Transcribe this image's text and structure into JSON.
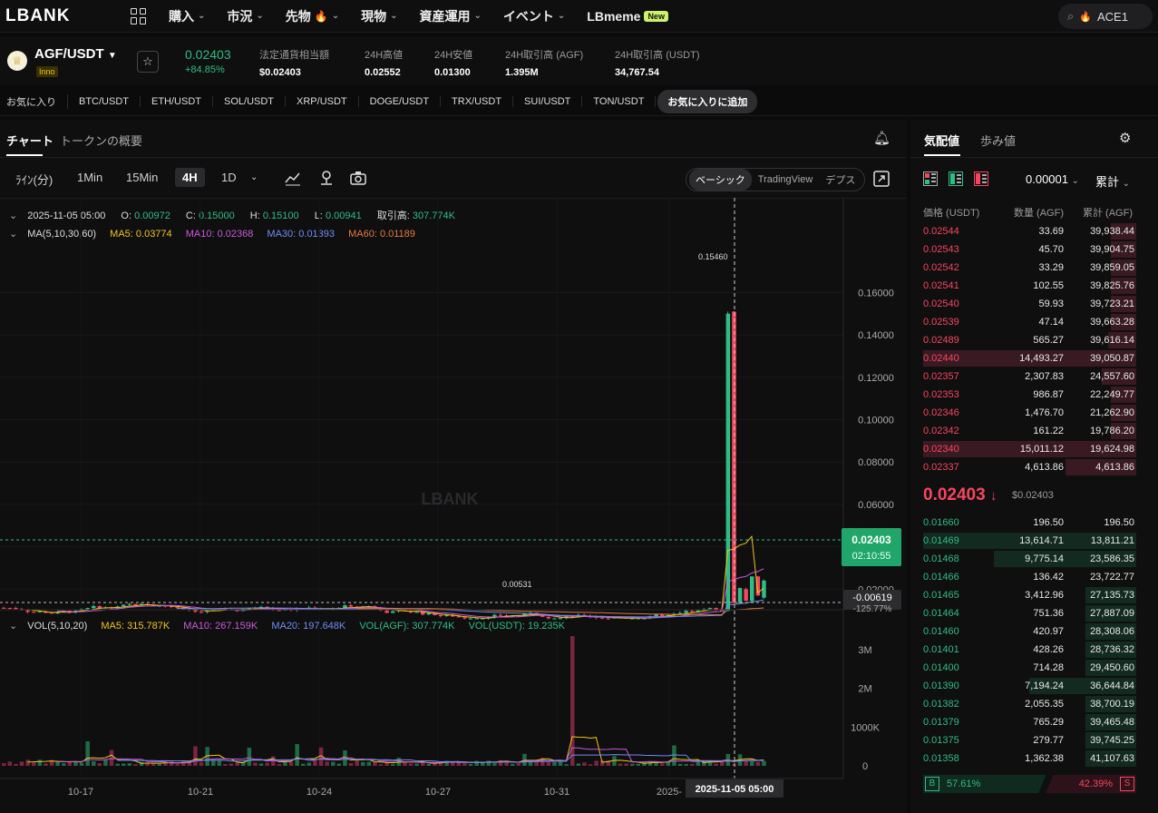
{
  "nav": {
    "logo": "LBANK",
    "items": [
      {
        "label": "購入",
        "chevron": true,
        "fire": false
      },
      {
        "label": "市況",
        "chevron": true,
        "fire": false
      },
      {
        "label": "先物",
        "chevron": true,
        "fire": true
      },
      {
        "label": "現物",
        "chevron": true,
        "fire": false
      },
      {
        "label": "資産運用",
        "chevron": true,
        "fire": false
      },
      {
        "label": "イベント",
        "chevron": true,
        "fire": false
      },
      {
        "label": "LBmeme",
        "chevron": false,
        "fire": false
      }
    ],
    "new_badge": "New",
    "search_value": "ACE1"
  },
  "ticker": {
    "pair": "AGF/USDT",
    "tag": "Inno",
    "price": "0.02403",
    "change": "+84.85%",
    "stats": [
      {
        "label": "法定通貨相当額",
        "value": "$0.02403"
      },
      {
        "label": "24H高値",
        "value": "0.02552"
      },
      {
        "label": "24H安値",
        "value": "0.01300"
      },
      {
        "label": "24H取引高 (AGF)",
        "value": "1.395M"
      },
      {
        "label": "24H取引高 (USDT)",
        "value": "34,767.54"
      }
    ]
  },
  "favbar": {
    "title": "お気に入り",
    "pairs": [
      "BTC/USDT",
      "ETH/USDT",
      "SOL/USDT",
      "XRP/USDT",
      "DOGE/USDT",
      "TRX/USDT",
      "SUI/USDT",
      "TON/USDT"
    ],
    "add_label": "お気に入りに追加"
  },
  "chart_panel": {
    "tabs": [
      "チャート",
      "トークンの概要"
    ],
    "timeframes": [
      "ﾗｲﾝ(分)",
      "1Min",
      "15Min",
      "4H",
      "1D"
    ],
    "active_timeframe": "4H",
    "views": [
      "ベーシック",
      "TradingView",
      "デプス"
    ],
    "active_view": "ベーシック",
    "ohlc": {
      "date": "2025-11-05 05:00",
      "o_label": "O:",
      "o": "0.00972",
      "c_label": "C:",
      "c": "0.15000",
      "h_label": "H:",
      "h": "0.15100",
      "l_label": "L:",
      "l": "0.00941",
      "vol_label": "取引高:",
      "vol": "307.774K"
    },
    "ma": {
      "label": "MA(5,10,30,60)",
      "ma5": "MA5: 0.03774",
      "ma10": "MA10: 0.02368",
      "ma30": "MA30: 0.01393",
      "ma60": "MA60: 0.01189"
    },
    "vol": {
      "label": "VOL(5,10,20)",
      "ma5": "MA5: 315.787K",
      "ma10": "MA10: 267.159K",
      "ma20": "MA20: 197.648K",
      "agf": "VOL(AGF): 307.774K",
      "usdt": "VOL(USDT): 19.235K"
    },
    "watermark": "LBANK",
    "price_tag": "0.02403",
    "countdown": "02:10:55",
    "low_tag": "-0.00619",
    "low_pct": "-125.77%",
    "high_marker": "0.15460",
    "low_marker": "0.00531",
    "crosshair_date": "2025-11-05 05:00"
  },
  "chart_data": {
    "type": "candlestick",
    "price_axis": {
      "ticks": [
        "0.16000",
        "0.14000",
        "0.12000",
        "0.10000",
        "0.08000",
        "0.06000",
        "0.04000",
        "0.02000"
      ],
      "range": [
        0,
        0.17
      ]
    },
    "volume_axis": {
      "ticks": [
        "3M",
        "2M",
        "1000K",
        "0"
      ],
      "range": [
        0,
        3500000
      ]
    },
    "x_ticks": [
      "10-17",
      "10-21",
      "10-24",
      "10-27",
      "10-31",
      "2025-"
    ],
    "notable": {
      "spike_high": 0.1546,
      "period_low": 0.00531,
      "last": 0.02403
    },
    "base_price": 0.0112,
    "spike_open": 0.00972,
    "spike_close": 0.15,
    "spike_high": 0.151
  },
  "orderbook": {
    "tabs": [
      "気配値",
      "歩み値"
    ],
    "tick": "0.00001",
    "mode": "累計",
    "cols": [
      "価格 (USDT)",
      "数量 (AGF)",
      "累計 (AGF)"
    ],
    "asks": [
      {
        "p": "0.02544",
        "q": "33.69",
        "t": "39,938.44",
        "d": 0.12
      },
      {
        "p": "0.02543",
        "q": "45.70",
        "t": "39,904.75",
        "d": 0.12
      },
      {
        "p": "0.02542",
        "q": "33.29",
        "t": "39,859.05",
        "d": 0.12
      },
      {
        "p": "0.02541",
        "q": "102.55",
        "t": "39,825.76",
        "d": 0.12
      },
      {
        "p": "0.02540",
        "q": "59.93",
        "t": "39,723.21",
        "d": 0.12
      },
      {
        "p": "0.02539",
        "q": "47.14",
        "t": "39,663.28",
        "d": 0.12
      },
      {
        "p": "0.02489",
        "q": "565.27",
        "t": "39,616.14",
        "d": 0.13
      },
      {
        "p": "0.02440",
        "q": "14,493.27",
        "t": "39,050.87",
        "d": 1.0
      },
      {
        "p": "0.02357",
        "q": "2,307.83",
        "t": "24,557.60",
        "d": 0.16
      },
      {
        "p": "0.02353",
        "q": "986.87",
        "t": "22,249.77",
        "d": 0.12
      },
      {
        "p": "0.02346",
        "q": "1,476.70",
        "t": "21,262.90",
        "d": 0.12
      },
      {
        "p": "0.02342",
        "q": "161.22",
        "t": "19,786.20",
        "d": 0.12
      },
      {
        "p": "0.02340",
        "q": "15,011.12",
        "t": "19,624.98",
        "d": 1.0
      },
      {
        "p": "0.02337",
        "q": "4,613.86",
        "t": "4,613.86",
        "d": 0.33
      }
    ],
    "mid_price": "0.02403",
    "mid_fiat": "$0.02403",
    "bids": [
      {
        "p": "0.01660",
        "q": "196.50",
        "t": "196.50",
        "d": 0.0
      },
      {
        "p": "0.01469",
        "q": "13,614.71",
        "t": "13,811.21",
        "d": 1.0
      },
      {
        "p": "0.01468",
        "q": "9,775.14",
        "t": "23,586.35",
        "d": 0.67
      },
      {
        "p": "0.01466",
        "q": "136.42",
        "t": "23,722.77",
        "d": 0.0
      },
      {
        "p": "0.01465",
        "q": "3,412.96",
        "t": "27,135.73",
        "d": 0.24
      },
      {
        "p": "0.01464",
        "q": "751.36",
        "t": "27,887.09",
        "d": 0.24
      },
      {
        "p": "0.01460",
        "q": "420.97",
        "t": "28,308.06",
        "d": 0.24
      },
      {
        "p": "0.01401",
        "q": "428.26",
        "t": "28,736.32",
        "d": 0.24
      },
      {
        "p": "0.01400",
        "q": "714.28",
        "t": "29,450.60",
        "d": 0.24
      },
      {
        "p": "0.01390",
        "q": "7,194.24",
        "t": "36,644.84",
        "d": 0.5
      },
      {
        "p": "0.01382",
        "q": "2,055.35",
        "t": "38,700.19",
        "d": 0.24
      },
      {
        "p": "0.01379",
        "q": "765.29",
        "t": "39,465.48",
        "d": 0.24
      },
      {
        "p": "0.01375",
        "q": "279.77",
        "t": "39,745.25",
        "d": 0.24
      },
      {
        "p": "0.01358",
        "q": "1,362.38",
        "t": "41,107.63",
        "d": 0.24
      }
    ],
    "buy_label": "B",
    "buy_pct": "57.61%",
    "sell_label": "S",
    "sell_pct": "42.39%",
    "buy_ratio": 0.5761
  },
  "colors": {
    "up": "#2ebd85",
    "down": "#f6465d",
    "ma5": "#f0c51a",
    "ma10": "#c85bd6",
    "ma30": "#6e8ff0",
    "ma60": "#e07b3c",
    "vol_up": "#1f6b46",
    "vol_down": "#7a2640"
  }
}
